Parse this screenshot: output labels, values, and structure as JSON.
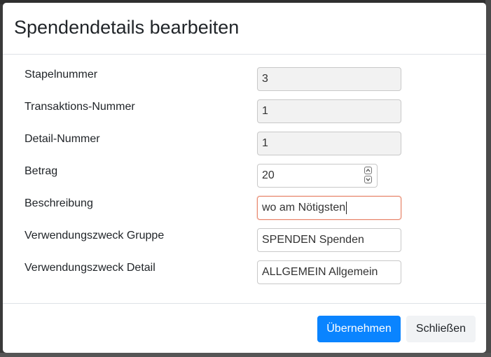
{
  "dialog": {
    "title": "Spendendetails bearbeiten"
  },
  "form": {
    "fields": [
      {
        "label": "Stapelnummer",
        "value": "3"
      },
      {
        "label": "Transaktions-Nummer",
        "value": "1"
      },
      {
        "label": "Detail-Nummer",
        "value": "1"
      },
      {
        "label": "Betrag",
        "value": "20"
      },
      {
        "label": "Beschreibung",
        "value": "wo am Nötigsten"
      },
      {
        "label": "Verwendungszweck Gruppe",
        "value": "SPENDEN Spenden"
      },
      {
        "label": "Verwendungszweck Detail",
        "value": "ALLGEMEIN Allgemein"
      }
    ]
  },
  "footer": {
    "apply_label": "Übernehmen",
    "close_label": "Schließen"
  },
  "colors": {
    "primary": "#0a84ff",
    "focus_border": "#e8876d",
    "readonly_bg": "#f2f2f2"
  },
  "icons": {
    "spinner_up": "chevron-up-icon",
    "spinner_down": "chevron-down-icon"
  }
}
